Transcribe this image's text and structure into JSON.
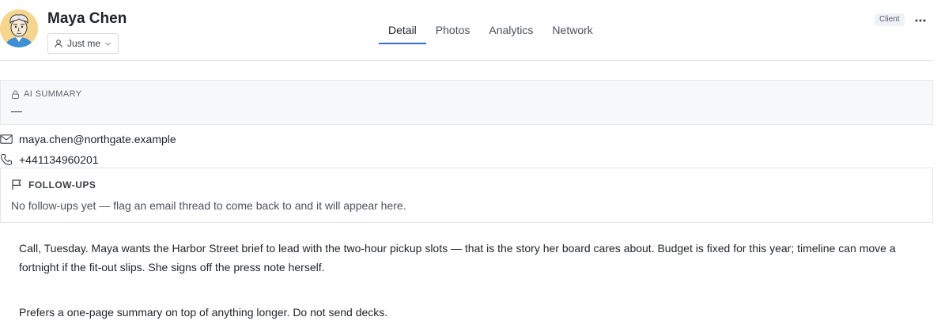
{
  "contact": {
    "name": "Maya Chen",
    "badge": "Client"
  },
  "scope": {
    "selected": "Just me"
  },
  "tabs": [
    {
      "label": "Detail",
      "active": true
    },
    {
      "label": "Photos",
      "active": false
    },
    {
      "label": "Analytics",
      "active": false
    },
    {
      "label": "Network",
      "active": false
    }
  ],
  "ai_summary": {
    "label": "AI SUMMARY",
    "value": "—"
  },
  "details": {
    "email": "maya.chen@northgate.example",
    "phone": "+441134960201"
  },
  "followups": {
    "title": "FOLLOW-UPS",
    "empty_text": "No follow-ups yet — flag an email thread to come back to and it will appear here."
  },
  "notes": [
    "Call, Tuesday. Maya wants the Harbor Street brief to lead with the two-hour pickup slots — that is the story her board cares about. Budget is fixed for this year; timeline can move a fortnight if the fit-out slips. She signs off the press note herself.",
    "Prefers a one-page summary on top of anything longer. Do not send decks."
  ],
  "icons": {
    "avatar": "avatar-illustration",
    "scope": "person-icon",
    "scope_caret": "chevron-down-icon",
    "more": "more-horizontal-icon",
    "ai": "lock-icon",
    "email": "mail-icon",
    "phone": "phone-icon",
    "followups": "flag-icon"
  },
  "colors": {
    "accent": "#2f6fd6",
    "avatar_bg": "#f6d58e"
  }
}
